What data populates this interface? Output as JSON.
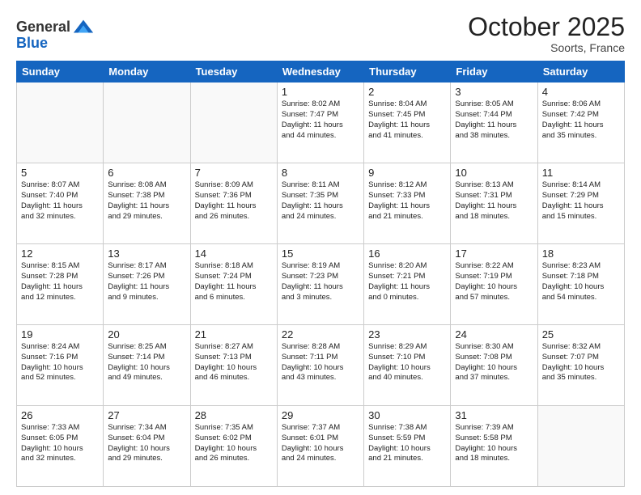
{
  "header": {
    "logo_line1": "General",
    "logo_line2": "Blue",
    "month": "October 2025",
    "location": "Soorts, France"
  },
  "weekdays": [
    "Sunday",
    "Monday",
    "Tuesday",
    "Wednesday",
    "Thursday",
    "Friday",
    "Saturday"
  ],
  "weeks": [
    [
      {
        "day": "",
        "info": ""
      },
      {
        "day": "",
        "info": ""
      },
      {
        "day": "",
        "info": ""
      },
      {
        "day": "1",
        "info": "Sunrise: 8:02 AM\nSunset: 7:47 PM\nDaylight: 11 hours\nand 44 minutes."
      },
      {
        "day": "2",
        "info": "Sunrise: 8:04 AM\nSunset: 7:45 PM\nDaylight: 11 hours\nand 41 minutes."
      },
      {
        "day": "3",
        "info": "Sunrise: 8:05 AM\nSunset: 7:44 PM\nDaylight: 11 hours\nand 38 minutes."
      },
      {
        "day": "4",
        "info": "Sunrise: 8:06 AM\nSunset: 7:42 PM\nDaylight: 11 hours\nand 35 minutes."
      }
    ],
    [
      {
        "day": "5",
        "info": "Sunrise: 8:07 AM\nSunset: 7:40 PM\nDaylight: 11 hours\nand 32 minutes."
      },
      {
        "day": "6",
        "info": "Sunrise: 8:08 AM\nSunset: 7:38 PM\nDaylight: 11 hours\nand 29 minutes."
      },
      {
        "day": "7",
        "info": "Sunrise: 8:09 AM\nSunset: 7:36 PM\nDaylight: 11 hours\nand 26 minutes."
      },
      {
        "day": "8",
        "info": "Sunrise: 8:11 AM\nSunset: 7:35 PM\nDaylight: 11 hours\nand 24 minutes."
      },
      {
        "day": "9",
        "info": "Sunrise: 8:12 AM\nSunset: 7:33 PM\nDaylight: 11 hours\nand 21 minutes."
      },
      {
        "day": "10",
        "info": "Sunrise: 8:13 AM\nSunset: 7:31 PM\nDaylight: 11 hours\nand 18 minutes."
      },
      {
        "day": "11",
        "info": "Sunrise: 8:14 AM\nSunset: 7:29 PM\nDaylight: 11 hours\nand 15 minutes."
      }
    ],
    [
      {
        "day": "12",
        "info": "Sunrise: 8:15 AM\nSunset: 7:28 PM\nDaylight: 11 hours\nand 12 minutes."
      },
      {
        "day": "13",
        "info": "Sunrise: 8:17 AM\nSunset: 7:26 PM\nDaylight: 11 hours\nand 9 minutes."
      },
      {
        "day": "14",
        "info": "Sunrise: 8:18 AM\nSunset: 7:24 PM\nDaylight: 11 hours\nand 6 minutes."
      },
      {
        "day": "15",
        "info": "Sunrise: 8:19 AM\nSunset: 7:23 PM\nDaylight: 11 hours\nand 3 minutes."
      },
      {
        "day": "16",
        "info": "Sunrise: 8:20 AM\nSunset: 7:21 PM\nDaylight: 11 hours\nand 0 minutes."
      },
      {
        "day": "17",
        "info": "Sunrise: 8:22 AM\nSunset: 7:19 PM\nDaylight: 10 hours\nand 57 minutes."
      },
      {
        "day": "18",
        "info": "Sunrise: 8:23 AM\nSunset: 7:18 PM\nDaylight: 10 hours\nand 54 minutes."
      }
    ],
    [
      {
        "day": "19",
        "info": "Sunrise: 8:24 AM\nSunset: 7:16 PM\nDaylight: 10 hours\nand 52 minutes."
      },
      {
        "day": "20",
        "info": "Sunrise: 8:25 AM\nSunset: 7:14 PM\nDaylight: 10 hours\nand 49 minutes."
      },
      {
        "day": "21",
        "info": "Sunrise: 8:27 AM\nSunset: 7:13 PM\nDaylight: 10 hours\nand 46 minutes."
      },
      {
        "day": "22",
        "info": "Sunrise: 8:28 AM\nSunset: 7:11 PM\nDaylight: 10 hours\nand 43 minutes."
      },
      {
        "day": "23",
        "info": "Sunrise: 8:29 AM\nSunset: 7:10 PM\nDaylight: 10 hours\nand 40 minutes."
      },
      {
        "day": "24",
        "info": "Sunrise: 8:30 AM\nSunset: 7:08 PM\nDaylight: 10 hours\nand 37 minutes."
      },
      {
        "day": "25",
        "info": "Sunrise: 8:32 AM\nSunset: 7:07 PM\nDaylight: 10 hours\nand 35 minutes."
      }
    ],
    [
      {
        "day": "26",
        "info": "Sunrise: 7:33 AM\nSunset: 6:05 PM\nDaylight: 10 hours\nand 32 minutes."
      },
      {
        "day": "27",
        "info": "Sunrise: 7:34 AM\nSunset: 6:04 PM\nDaylight: 10 hours\nand 29 minutes."
      },
      {
        "day": "28",
        "info": "Sunrise: 7:35 AM\nSunset: 6:02 PM\nDaylight: 10 hours\nand 26 minutes."
      },
      {
        "day": "29",
        "info": "Sunrise: 7:37 AM\nSunset: 6:01 PM\nDaylight: 10 hours\nand 24 minutes."
      },
      {
        "day": "30",
        "info": "Sunrise: 7:38 AM\nSunset: 5:59 PM\nDaylight: 10 hours\nand 21 minutes."
      },
      {
        "day": "31",
        "info": "Sunrise: 7:39 AM\nSunset: 5:58 PM\nDaylight: 10 hours\nand 18 minutes."
      },
      {
        "day": "",
        "info": ""
      }
    ]
  ]
}
